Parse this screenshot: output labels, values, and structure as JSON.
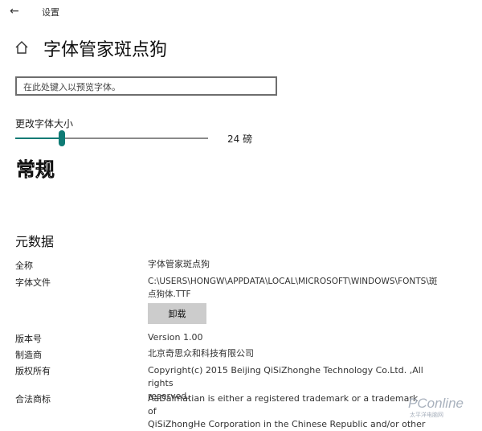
{
  "window": {
    "title": "设置",
    "back_icon": "back-arrow-icon"
  },
  "header": {
    "home_icon": "home-icon",
    "title": "字体管家斑点狗"
  },
  "search": {
    "placeholder": "在此处键入以预览字体。",
    "value": ""
  },
  "font_size": {
    "label": "更改字体大小",
    "value_text": "24 磅",
    "value": 24,
    "slider_fraction": 0.24
  },
  "preview": {
    "text": "常规",
    "style": "dalmatian-spotted"
  },
  "metadata": {
    "title": "元数据",
    "full_name": {
      "label": "全称",
      "value": "字体管家斑点狗"
    },
    "font_file": {
      "label": "字体文件",
      "value_line1": "C:\\USERS\\HONGW\\APPDATA\\LOCAL\\MICROSOFT\\WINDOWS\\FONTS\\斑",
      "value_line2": "点狗体.TTF"
    },
    "uninstall_label": "卸载",
    "version": {
      "label": "版本号",
      "value": "Version 1.00"
    },
    "manufacturer": {
      "label": "制造商",
      "value": "北京奇思众和科技有限公司"
    },
    "copyright": {
      "label": "版权所有",
      "value_line1": "Copyright(c) 2015 Beijing QiSiZhonghe Technology Co.Ltd. ,All rights",
      "value_line2": "reserved."
    },
    "trademark": {
      "label": "合法商标",
      "value_line1": "AaDalmatian is either a registered trademark or a trademark of",
      "value_line2": "QiSiZhongHe Corporation in the Chinese Republic and/or other"
    }
  },
  "watermark": {
    "logo": "PConline",
    "sub": "太平洋电脑网"
  },
  "colors": {
    "accent": "#0f7b75",
    "button_bg": "#cccccc",
    "text": "#1a1a1a"
  }
}
